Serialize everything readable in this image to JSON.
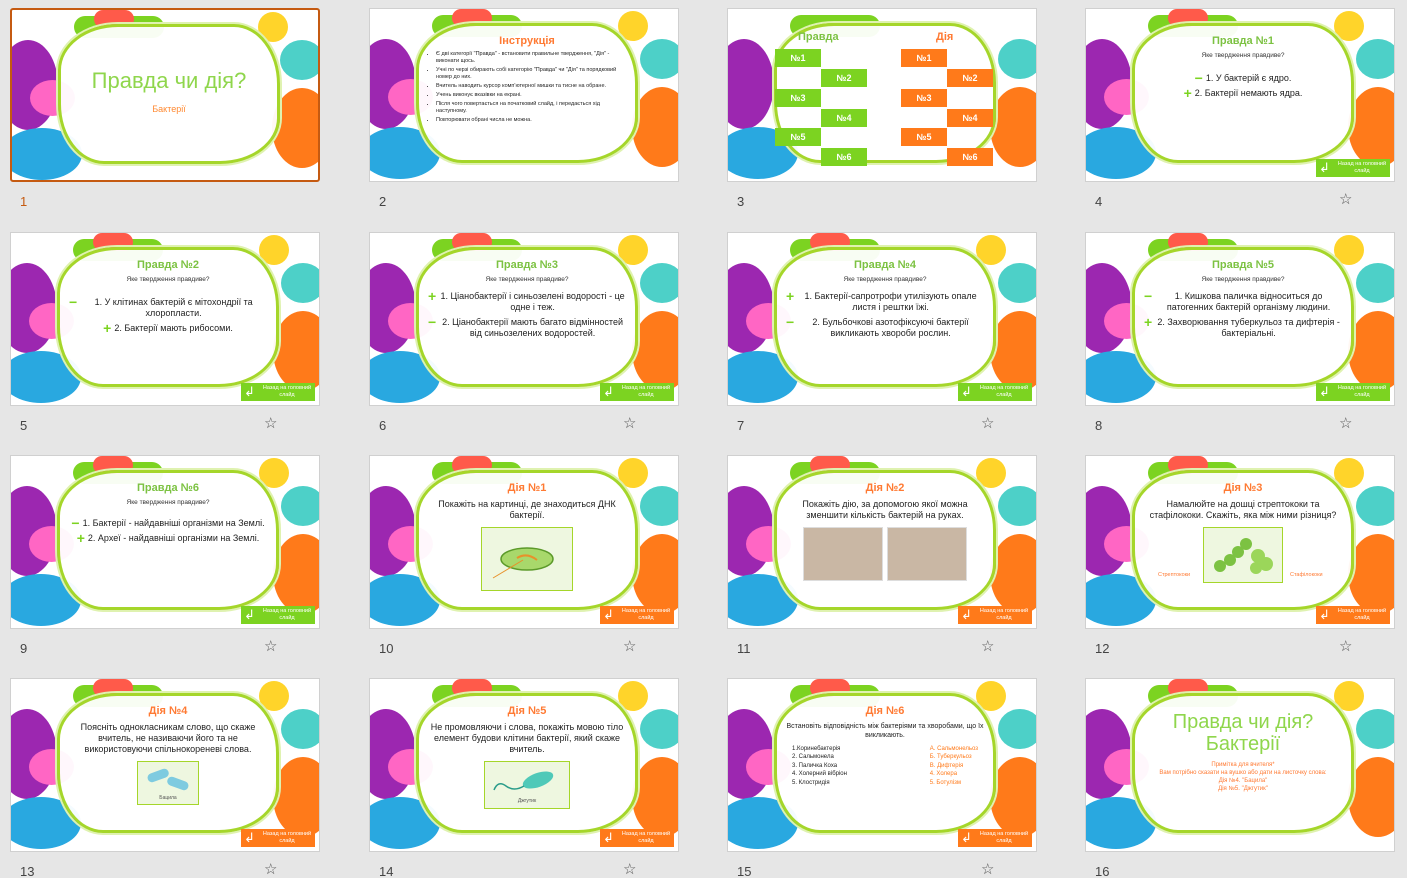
{
  "slides": [
    {
      "number": "1",
      "title": "Правда чи дія?",
      "subtitle": "Бактерії"
    },
    {
      "number": "2",
      "title": "Інструкція",
      "items": [
        "Є дві категорії \"Правда\" - встановити правильне твердження, \"Дія\" - виконати щось.",
        "Учні по черзі обирають собі категорію \"Правда\" чи \"Дія\" та порядковий номер до них.",
        "Вчитель наводить курсор комп'ютерної мишки та тисне на обране.",
        "Учень виконує вказівки на екрані.",
        "Після чого повертається на початковий слайд, і передається хід наступному.",
        "Повторювати обрані числа не можна."
      ]
    },
    {
      "number": "3",
      "truth_label": "Правда",
      "dare_label": "Дія",
      "truth_tiles": [
        "№1",
        "№2",
        "№3",
        "№4",
        "№5",
        "№6"
      ],
      "dare_tiles": [
        "№1",
        "№2",
        "№3",
        "№4",
        "№5",
        "№6"
      ]
    },
    {
      "number": "4",
      "title": "Правда №1",
      "question": "Яке твердження правдиве?",
      "s1": "1. У бактерій є ядро.",
      "s2": "2. Бактерії немають ядра."
    },
    {
      "number": "5",
      "title": "Правда №2",
      "question": "Яке твердження правдиве?",
      "s1": "1. У клітинах бактерій є мітохондрії та хлоропласти.",
      "s2": "2. Бактерії мають рибосоми."
    },
    {
      "number": "6",
      "title": "Правда №3",
      "question": "Яке твердження правдиве?",
      "s1": "1. Ціанобактерії і синьозелені водорості - це одне і теж.",
      "s2": "2. Ціанобактерії мають багато відмінностей від синьозелених водоростей."
    },
    {
      "number": "7",
      "title": "Правда №4",
      "question": "Яке твердження правдиве?",
      "s1": "1. Бактерії-сапротрофи утилізують опале листя і рештки їжі.",
      "s2": "2. Бульбочкові азотофіксуючі бактерії викликають хвороби рослин."
    },
    {
      "number": "8",
      "title": "Правда №5",
      "question": "Яке твердження правдиве?",
      "s1": "1. Кишкова паличка відноситься до патогенних бактерій організму людини.",
      "s2": "2. Захворювання туберкульоз та дифтерія - бактеріальні."
    },
    {
      "number": "9",
      "title": "Правда №6",
      "question": "Яке твердження правдиве?",
      "s1": "1. Бактерії - найдавніші організми на Землі.",
      "s2": "2. Археї - найдавніші організми на Землі."
    },
    {
      "number": "10",
      "title": "Дія №1",
      "task": "Покажіть на картинці, де знаходиться ДНК бактерії."
    },
    {
      "number": "11",
      "title": "Дія №2",
      "task": "Покажіть дію, за допомогою якої можна зменшити кількість бактерій на руках."
    },
    {
      "number": "12",
      "title": "Дія №3",
      "task": "Намалюйте на дошці стрептококи та стафілококи. Скажіть, яка між ними різниця?",
      "left_label": "Стрептококи",
      "right_label": "Стафілококи"
    },
    {
      "number": "13",
      "title": "Дія №4",
      "task": "Поясніть однокласникам слово, що скаже вчитель, не називаючи його та не використовуючи спільнокореневі слова.",
      "caption": "Бацила"
    },
    {
      "number": "14",
      "title": "Дія №5",
      "task": "Не промовляючи і слова, покажіть мовою тіло елемент будови клітини бактерії, який скаже вчитель.",
      "caption": "Джгутик"
    },
    {
      "number": "15",
      "title": "Дія №6",
      "task": "Встановіть відповідність між бактеріями та хворобами, що їх викликають.",
      "left": [
        "1.Коринебактерія",
        "2. Сальмонела",
        "3. Паличка Коха",
        "4. Холерний вібріон",
        "5. Клостридія"
      ],
      "right": [
        "А. Сальмонельоз",
        "Б. Туберкульоз",
        "В. Дифтерія",
        "4. Холера",
        "5. Ботулізм"
      ]
    },
    {
      "number": "16",
      "title1": "Правда чи дія?",
      "title2": "Бактерії",
      "n1": "Примітка для вчителя*",
      "n2": "Вам потрібно сказати на вушко або дати на листочку слова:",
      "n3": "Дія №4. \"Бацила\"",
      "n4": "Дія №5. \"Джгутик\""
    }
  ],
  "back_label": "Назад на головний слайд",
  "colors": {
    "green": "#7cd321",
    "orange": "#ff7a1a",
    "selected": "#c55a11"
  }
}
